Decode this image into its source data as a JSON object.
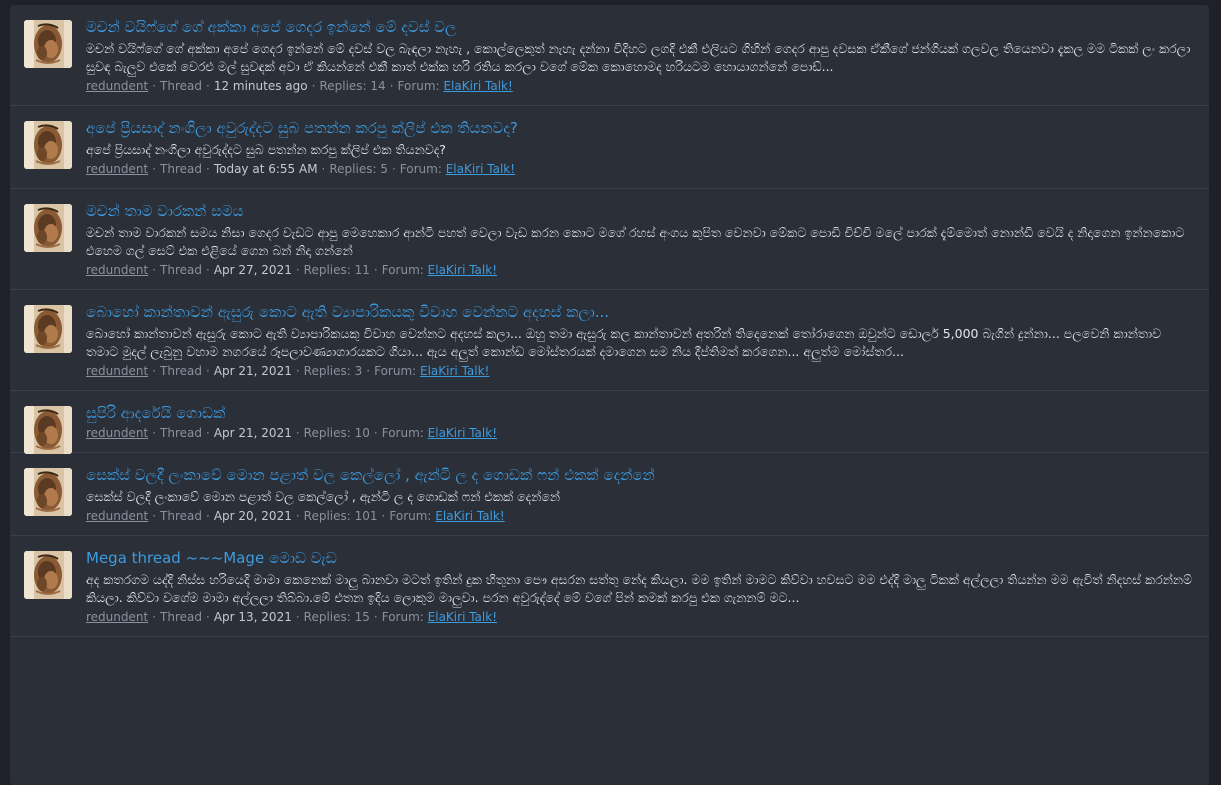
{
  "results": [
    {
      "title": "මචන් වයිෆ්ගේ ගේ අක්කා අපේ ගෙදර ඉන්නේ මේ දවස් වල",
      "snippet": "මචන් වයිෆ්ගේ ගේ අක්කා අපේ ගෙදර ඉන්නේ මේ දවස් වල බැඳලා නැහැ , කොල්ලෙකුත් නැහැ දන්නා විදිහට ලගදි එකී එලියට ගිහින් ගෙදර ආපු දවසක ඒකීගේ ජන්ගියක් ගලවල තියෙනවා දැකල මම ටිකක් ලං කරලා සුවඳ බැලුව එකේ වෙරළු මල් සුවඳක් අවා ඒ කියන්නේ එකී කාත් එක්ක හරි රතිය කරලා වගේ මේක කොහොමද හරියටම හොයාගන්නේ පොඩ්...",
      "user": "redundent",
      "type": "Thread",
      "date": "12 minutes ago",
      "replies": "Replies: 14",
      "forum_label": "Forum:",
      "forum": "ElaKiri Talk!"
    },
    {
      "title": "අපේ ප්‍රියසාද් නංගිලා අවුරුද්දට සුබ පතන්න කරපු ක්ලිප් එක තියනවද?",
      "snippet": "අපේ ප්‍රියසාද් නංගිලා අවුරුද්දට සුබ පතන්න කරපු ක්ලිප් එක තියනවද?",
      "user": "redundent",
      "type": "Thread",
      "date": "Today at 6:55 AM",
      "replies": "Replies: 5",
      "forum_label": "Forum:",
      "forum": "ElaKiri Talk!"
    },
    {
      "title": "මචන් තාම වාරකන් සමය",
      "snippet": "මචන් තාම වාරකන් සමය නිසා ගෙදර වැඩට ආපු මෙහෙකාර ආන්ටි පහත් වෙලා වැඩ කරන කොට මගේ රහස් අංගය කුපිත වෙනවා මේකට පොඩි චිච්චි මලේ පාරක් දැම්මොත් නොන්ඩි වෙයි ද නිදාගෙන ඉන්නකොට එහෙම ගල් සෙට් එක එළියේ ගෙන බන් නිදා ගන්නේ",
      "user": "redundent",
      "type": "Thread",
      "date": "Apr 27, 2021",
      "replies": "Replies: 11",
      "forum_label": "Forum:",
      "forum": "ElaKiri Talk!"
    },
    {
      "title": "බොහෝ කාන්තාවන් ඇසුරු කොට ඇති ව්‍යාපාරිකයකු විවාහ වෙන්නට අදහස් කලා...",
      "snippet": "බොහෝ කාන්තාවන් ඇසුරු කොට ඇති ව්‍යාපාරිකයකු විවාහ වෙන්නට අදහස් කලා... ඔහු තමා ඇසුරු කල කාන්තාවන් අතරින් තිදෙනෙක් තෝරාගෙන ඔවුන්ට ඩොලර් 5,000 බැගින් දුන්නා... පලවෙනි කාන්තාව තමාට මුදල් ලැබුනු වහාම නගරයේ රූපලාවණ්‍යාගාරයකට ගියා... ඇය අලුත් කොන්ඩ මෝස්තරයක් දමාගෙන සම නිය දීප්තිමත් කරගෙන... අලුත්ම මෝස්තර...",
      "user": "redundent",
      "type": "Thread",
      "date": "Apr 21, 2021",
      "replies": "Replies: 3",
      "forum_label": "Forum:",
      "forum": "ElaKiri Talk!"
    },
    {
      "title": "සුපිරි ආදරේයි ගොඩක්",
      "snippet": "",
      "user": "redundent",
      "type": "Thread",
      "date": "Apr 21, 2021",
      "replies": "Replies: 10",
      "forum_label": "Forum:",
      "forum": "ElaKiri Talk!"
    },
    {
      "title": "සෙක්ස් වලදී ලංකාවේ මොන පළාත් වල කෙල්ලෝ , ඇන්ටි ල ද ගොඩක් ෆන් එකක් දෙන්නේ",
      "snippet": "සෙක්ස් වලදී ලංකාවේ මොන පළාත් වල කෙල්ලෝ , ඇන්ටි ල ද ගොඩක් ෆන් එකක් දෙන්නේ",
      "user": "redundent",
      "type": "Thread",
      "date": "Apr 20, 2021",
      "replies": "Replies: 101",
      "forum_label": "Forum:",
      "forum": "ElaKiri Talk!"
    },
    {
      "title": "Mega thread ~~~Mage මොඩ වැඩ",
      "snippet": "අද කතරගම යද්දි නිස්ස හරියෙදි මාමා කෙනෙක් මාලු බානවා මටත් ඉතින් දුක හිතුනා පෞ අසරන සත්තු නේද කියලා. මම ඉතින් මාමට කිව්වා හවසට මම එද්දි මාලු ටිකක් අල්ලලා තියන්න මම ඇවිත් නිදහස් කරන්නම් කියලා. කිව්වා වගේම මාමා අල්ලලා තිබ්බා.මේ එතන ඉදිය ලොකුම මාලුවා. පරන අවුරුද්දේ මේ වගේ පින් කමක් කරපු එක ගැනනම් මට...",
      "user": "redundent",
      "type": "Thread",
      "date": "Apr 13, 2021",
      "replies": "Replies: 15",
      "forum_label": "Forum:",
      "forum": "ElaKiri Talk!"
    }
  ]
}
